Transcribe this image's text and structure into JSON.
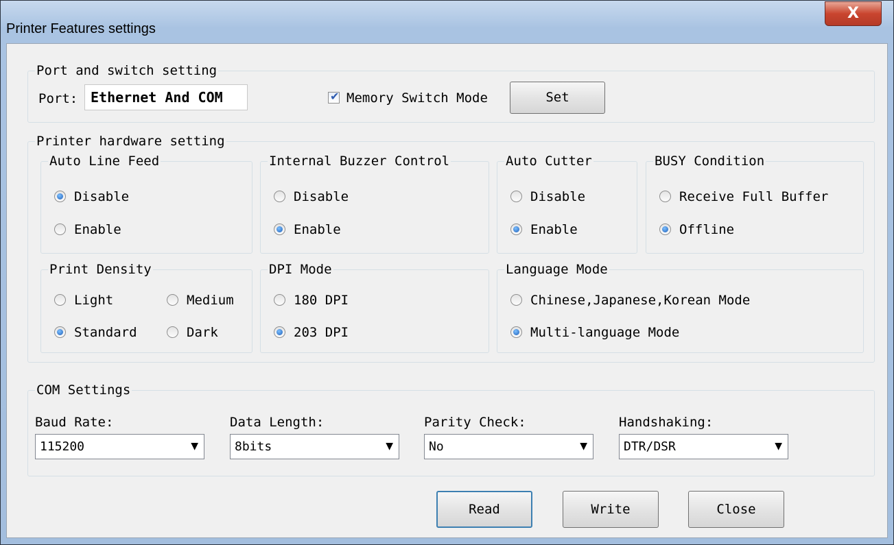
{
  "window": {
    "title": "Printer Features settings",
    "close_glyph": "X"
  },
  "port_switch": {
    "legend": "Port and switch setting",
    "port_label": "Port:",
    "port_value": "Ethernet And COM",
    "memory_switch_label": "Memory Switch Mode",
    "memory_switch_checked": true,
    "set_button": "Set"
  },
  "hardware": {
    "legend": "Printer hardware setting",
    "auto_line_feed": {
      "legend": "Auto Line Feed",
      "options": [
        "Disable",
        "Enable"
      ],
      "selected": "Disable"
    },
    "buzzer": {
      "legend": "Internal Buzzer Control",
      "options": [
        "Disable",
        "Enable"
      ],
      "selected": "Enable"
    },
    "auto_cutter": {
      "legend": "Auto Cutter",
      "options": [
        "Disable",
        "Enable"
      ],
      "selected": "Enable"
    },
    "busy": {
      "legend": "BUSY Condition",
      "options": [
        "Receive Full Buffer",
        "Offline"
      ],
      "selected": "Offline"
    },
    "density": {
      "legend": "Print Density",
      "options": [
        "Light",
        "Medium",
        "Standard",
        "Dark"
      ],
      "selected": "Standard"
    },
    "dpi": {
      "legend": "DPI Mode",
      "options": [
        "180 DPI",
        "203 DPI"
      ],
      "selected": "203 DPI"
    },
    "language": {
      "legend": "Language Mode",
      "options": [
        "Chinese,Japanese,Korean Mode",
        "Multi-language Mode"
      ],
      "selected": "Multi-language Mode"
    }
  },
  "com": {
    "legend": "COM Settings",
    "baud": {
      "label": "Baud Rate:",
      "value": "115200"
    },
    "data_length": {
      "label": "Data Length:",
      "value": "8bits"
    },
    "parity": {
      "label": "Parity Check:",
      "value": "No"
    },
    "handshaking": {
      "label": "Handshaking:",
      "value": "DTR/DSR"
    }
  },
  "buttons": {
    "read": "Read",
    "write": "Write",
    "close": "Close"
  },
  "colors": {
    "focus_border": "#3c7fb1",
    "close_button": "#c9452f",
    "radio_dot": "#1e5fb8",
    "check_mark": "#2f5cb0"
  }
}
